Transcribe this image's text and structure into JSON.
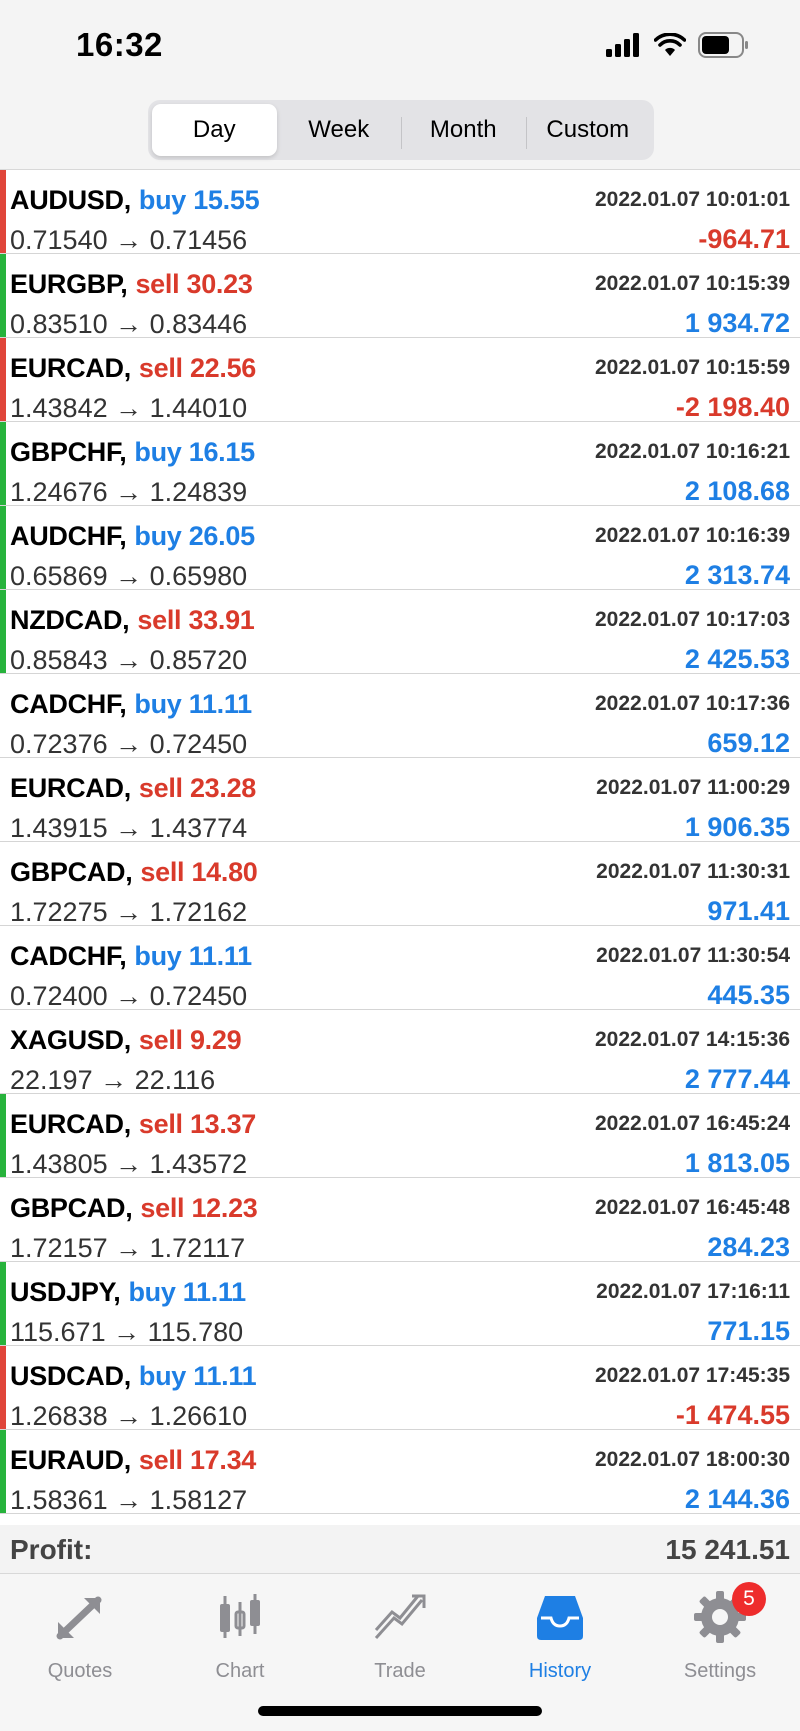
{
  "status": {
    "time": "16:32"
  },
  "periods": [
    {
      "label": "Day",
      "active": true
    },
    {
      "label": "Week",
      "active": false
    },
    {
      "label": "Month",
      "active": false
    },
    {
      "label": "Custom",
      "active": false
    }
  ],
  "colors": {
    "buy": "#1e7fe4",
    "sell": "#d93a2b",
    "bar_green": "#27b33c",
    "bar_red": "#e0453a"
  },
  "deals": [
    {
      "symbol": "AUDUSD,",
      "dir": "buy",
      "volume": "15.55",
      "prices": "0.71540 → 0.71456",
      "time": "2022.01.07 10:01:01",
      "profit": "-964.71",
      "bar": "red"
    },
    {
      "symbol": "EURGBP,",
      "dir": "sell",
      "volume": "30.23",
      "prices": "0.83510 → 0.83446",
      "time": "2022.01.07 10:15:39",
      "profit": "1 934.72",
      "bar": "green"
    },
    {
      "symbol": "EURCAD,",
      "dir": "sell",
      "volume": "22.56",
      "prices": "1.43842 → 1.44010",
      "time": "2022.01.07 10:15:59",
      "profit": "-2 198.40",
      "bar": "red"
    },
    {
      "symbol": "GBPCHF,",
      "dir": "buy",
      "volume": "16.15",
      "prices": "1.24676 → 1.24839",
      "time": "2022.01.07 10:16:21",
      "profit": "2 108.68",
      "bar": "green"
    },
    {
      "symbol": "AUDCHF,",
      "dir": "buy",
      "volume": "26.05",
      "prices": "0.65869 → 0.65980",
      "time": "2022.01.07 10:16:39",
      "profit": "2 313.74",
      "bar": "green"
    },
    {
      "symbol": "NZDCAD,",
      "dir": "sell",
      "volume": "33.91",
      "prices": "0.85843 → 0.85720",
      "time": "2022.01.07 10:17:03",
      "profit": "2 425.53",
      "bar": "green"
    },
    {
      "symbol": "CADCHF,",
      "dir": "buy",
      "volume": "11.11",
      "prices": "0.72376 → 0.72450",
      "time": "2022.01.07 10:17:36",
      "profit": "659.12",
      "bar": "none"
    },
    {
      "symbol": "EURCAD,",
      "dir": "sell",
      "volume": "23.28",
      "prices": "1.43915 → 1.43774",
      "time": "2022.01.07 11:00:29",
      "profit": "1 906.35",
      "bar": "none"
    },
    {
      "symbol": "GBPCAD,",
      "dir": "sell",
      "volume": "14.80",
      "prices": "1.72275 → 1.72162",
      "time": "2022.01.07 11:30:31",
      "profit": "971.41",
      "bar": "none"
    },
    {
      "symbol": "CADCHF,",
      "dir": "buy",
      "volume": "11.11",
      "prices": "0.72400 → 0.72450",
      "time": "2022.01.07 11:30:54",
      "profit": "445.35",
      "bar": "none"
    },
    {
      "symbol": "XAGUSD,",
      "dir": "sell",
      "volume": "9.29",
      "prices": "22.197 → 22.116",
      "time": "2022.01.07 14:15:36",
      "profit": "2 777.44",
      "bar": "none"
    },
    {
      "symbol": "EURCAD,",
      "dir": "sell",
      "volume": "13.37",
      "prices": "1.43805 → 1.43572",
      "time": "2022.01.07 16:45:24",
      "profit": "1 813.05",
      "bar": "green"
    },
    {
      "symbol": "GBPCAD,",
      "dir": "sell",
      "volume": "12.23",
      "prices": "1.72157 → 1.72117",
      "time": "2022.01.07 16:45:48",
      "profit": "284.23",
      "bar": "none"
    },
    {
      "symbol": "USDJPY,",
      "dir": "buy",
      "volume": "11.11",
      "prices": "115.671 → 115.780",
      "time": "2022.01.07 17:16:11",
      "profit": "771.15",
      "bar": "green"
    },
    {
      "symbol": "USDCAD,",
      "dir": "buy",
      "volume": "11.11",
      "prices": "1.26838 → 1.26610",
      "time": "2022.01.07 17:45:35",
      "profit": "-1 474.55",
      "bar": "red"
    },
    {
      "symbol": "EURAUD,",
      "dir": "sell",
      "volume": "17.34",
      "prices": "1.58361 → 1.58127",
      "time": "2022.01.07 18:00:30",
      "profit": "2 144.36",
      "bar": "green"
    }
  ],
  "summary": {
    "label": "Profit:",
    "value": "15 241.51"
  },
  "tabs": [
    {
      "label": "Quotes",
      "icon": "quotes-icon",
      "active": false
    },
    {
      "label": "Chart",
      "icon": "chart-icon",
      "active": false
    },
    {
      "label": "Trade",
      "icon": "trade-icon",
      "active": false
    },
    {
      "label": "History",
      "icon": "history-icon",
      "active": true
    },
    {
      "label": "Settings",
      "icon": "gear-icon",
      "active": false,
      "badge": "5"
    }
  ]
}
